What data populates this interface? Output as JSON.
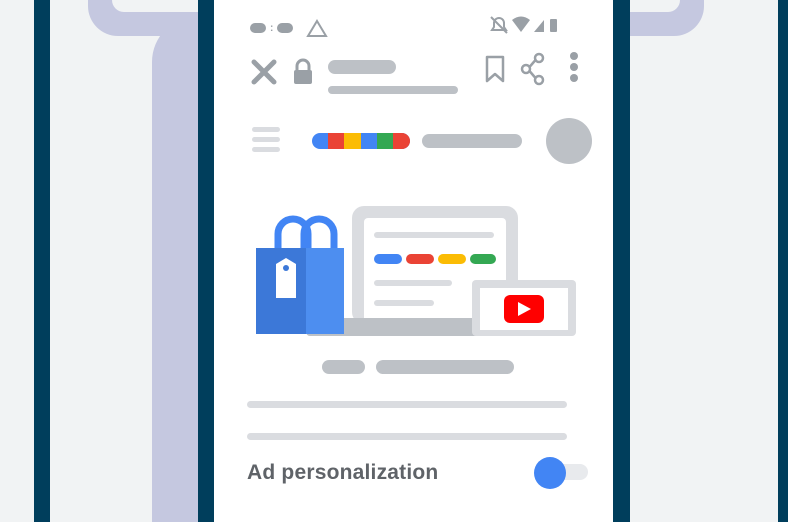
{
  "colors": {
    "frame": "#003e5c",
    "overlay": "#c5c8e0",
    "gray": "#bdc1c6",
    "icon_gray": "#9aa0a6",
    "blue": "#4285f4",
    "red": "#ea4335",
    "yellow": "#fbbc04",
    "green": "#34a853",
    "youtube_red": "#ff0000"
  },
  "browser": {
    "close_icon": "close-icon",
    "lock_icon": "lock-icon",
    "bookmark_icon": "bookmark-icon",
    "share_icon": "share-icon",
    "menu_icon": "more-vert-icon"
  },
  "settings": {
    "ad_personalization_label": "Ad personalization",
    "ad_personalization_on": true
  }
}
